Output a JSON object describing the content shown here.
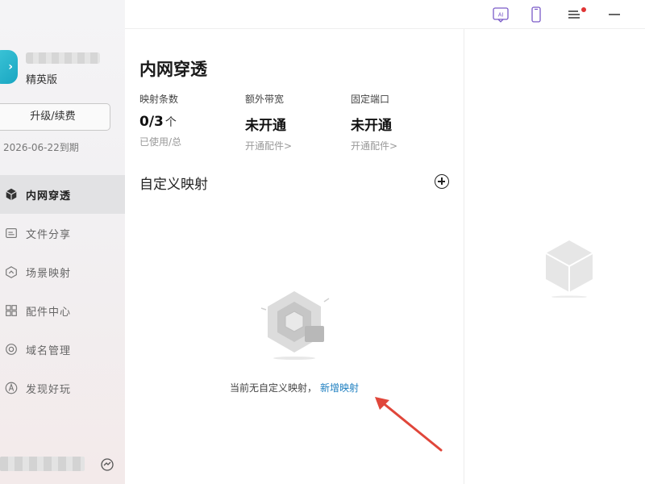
{
  "sidebar": {
    "account_name": "",
    "edition": "精英版",
    "upgrade_label": "升级/续费",
    "expire_text": "2026-06-22到期",
    "items": [
      {
        "label": "内网穿透",
        "icon": "cube-icon",
        "active": true
      },
      {
        "label": "文件分享",
        "icon": "file-share-icon",
        "active": false
      },
      {
        "label": "场景映射",
        "icon": "scene-icon",
        "active": false
      },
      {
        "label": "配件中心",
        "icon": "grid-icon",
        "active": false
      },
      {
        "label": "域名管理",
        "icon": "domain-icon",
        "active": false
      },
      {
        "label": "发现好玩",
        "icon": "compass-icon",
        "active": false
      }
    ]
  },
  "topbar": {
    "icons": [
      "ai-icon",
      "phone-icon",
      "menu-icon",
      "minimize-icon"
    ],
    "notification_color": "#e03434"
  },
  "main": {
    "title": "内网穿透",
    "stats": [
      {
        "label": "映射条数",
        "value": "0/3",
        "unit": "个",
        "sub": "已使用/总"
      },
      {
        "label": "额外带宽",
        "value": "未开通",
        "unit": "",
        "sub": "开通配件>"
      },
      {
        "label": "固定端口",
        "value": "未开通",
        "unit": "",
        "sub": "开通配件>"
      }
    ],
    "section_title": "自定义映射",
    "empty_text": "当前无自定义映射，",
    "empty_link": "新增映射"
  },
  "colors": {
    "accent_link": "#1e7fc0",
    "logo": "#19a6c2",
    "arrow": "#e0463a"
  }
}
